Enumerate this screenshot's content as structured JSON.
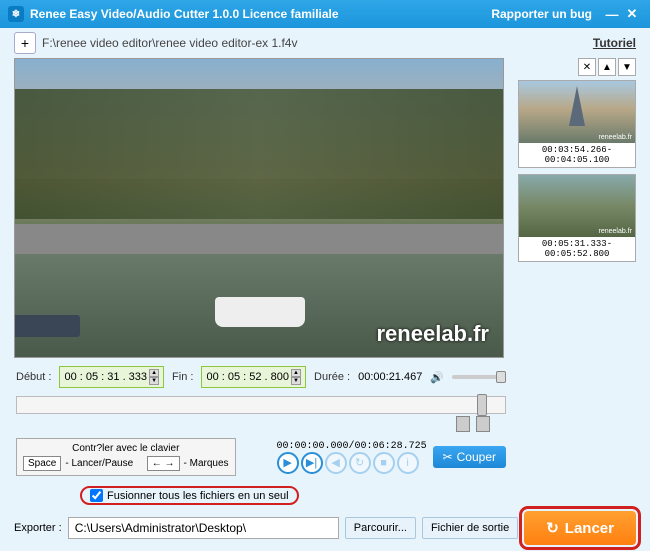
{
  "titlebar": {
    "product": "Renee Easy Video/Audio Cutter 1.0.0 Licence familiale",
    "bug": "Rapporter un bug"
  },
  "path": {
    "file": "F:\\renee video editor\\renee video editor-ex 1.f4v",
    "tutorial": "Tutoriel"
  },
  "preview": {
    "watermark": "reneelab.fr"
  },
  "time": {
    "start_label": "Début :",
    "start": "00 : 05 : 31 . 333",
    "end_label": "Fin :",
    "end": "00 : 05 : 52 . 800",
    "dur_label": "Durée :",
    "dur": "00:00:21.467"
  },
  "kb": {
    "title": "Contr?ler avec le clavier",
    "space": "Space",
    "pause": "- Lancer/Pause",
    "arrows": "← →",
    "marks": "- Marques"
  },
  "timecode": "00:00:00.000/00:06:28.725",
  "cut": "Couper",
  "clips": [
    {
      "range": "00:03:54.266-00:04:05.100",
      "wm": "reneelab.fr"
    },
    {
      "range": "00:05:31.333-00:05:52.800",
      "wm": "reneelab.fr"
    }
  ],
  "merge": "Fusionner tous les fichiers en un seul",
  "export": {
    "label": "Exporter :",
    "path": "C:\\Users\\Administrator\\Desktop\\",
    "browse": "Parcourir...",
    "folder": "Fichier de sortie",
    "launch": "Lancer"
  }
}
